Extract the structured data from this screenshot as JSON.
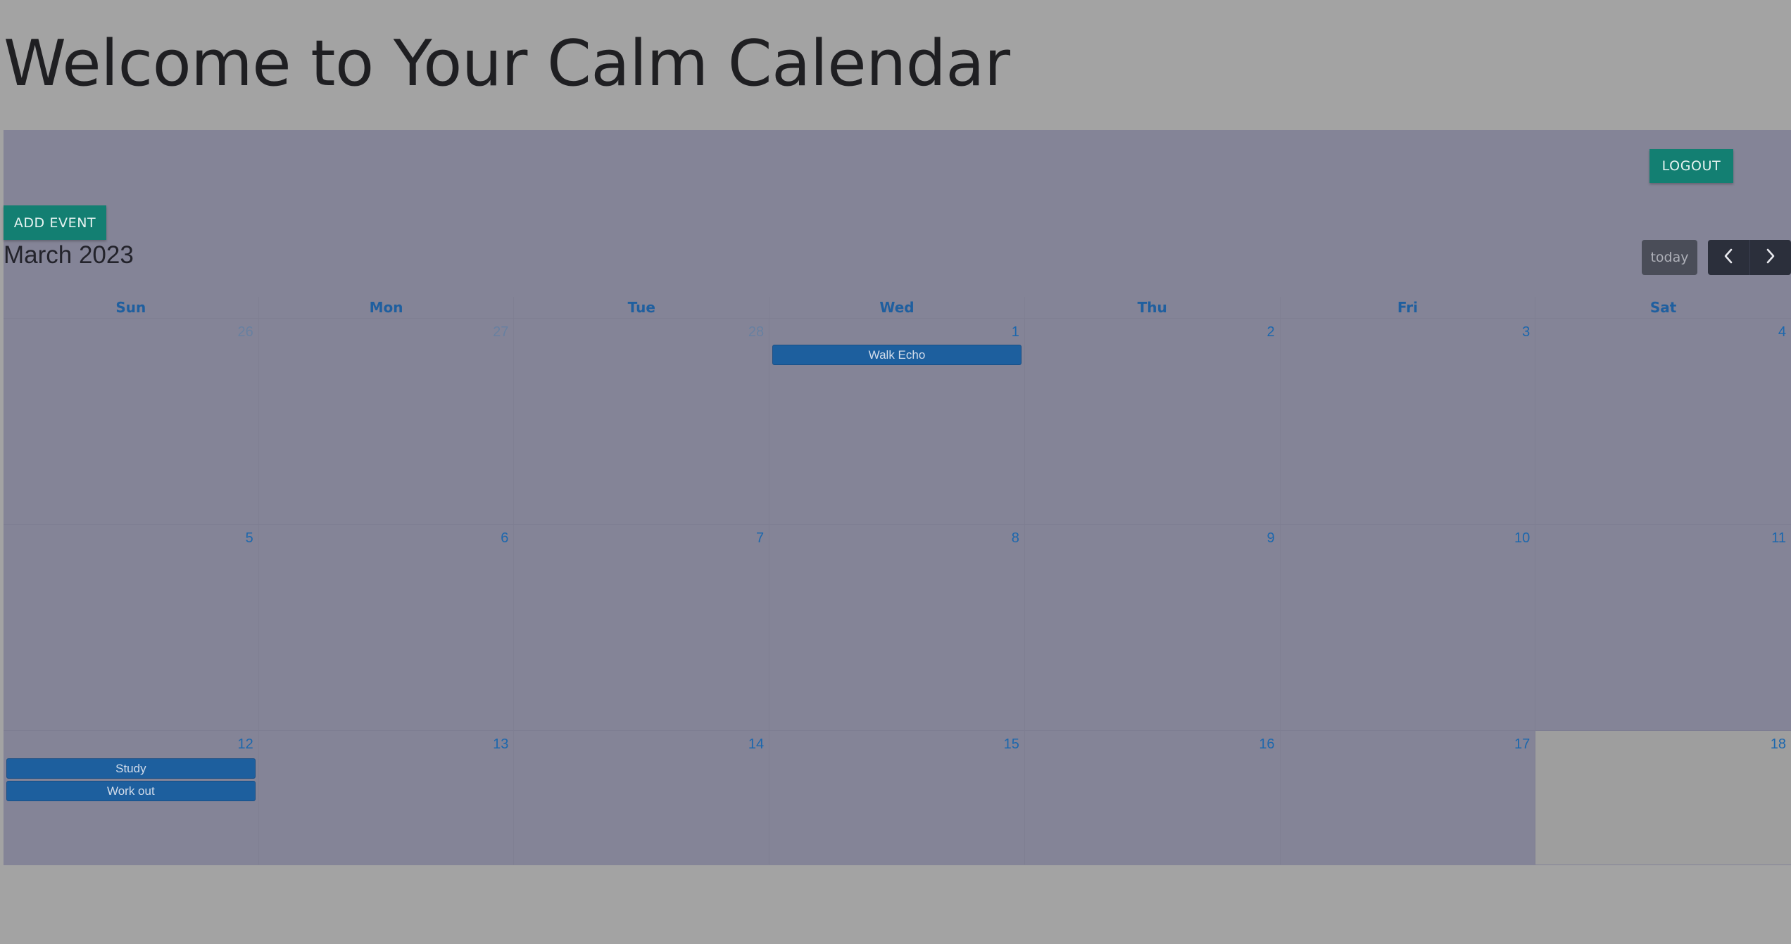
{
  "page": {
    "title": "Welcome to Your Calm Calendar"
  },
  "toolbar": {
    "logout_label": "LOGOUT",
    "add_event_label": "ADD EVENT",
    "month_title": "March 2023",
    "today_label": "today",
    "prev_icon": "chevron-left-icon",
    "next_icon": "chevron-right-icon"
  },
  "calendar": {
    "weekdays": [
      "Sun",
      "Mon",
      "Tue",
      "Wed",
      "Thu",
      "Fri",
      "Sat"
    ],
    "weeks": [
      {
        "days": [
          "26",
          "27",
          "28",
          "1",
          "2",
          "3",
          "4"
        ]
      },
      {
        "days": [
          "5",
          "6",
          "7",
          "8",
          "9",
          "10",
          "11"
        ]
      },
      {
        "days": [
          "12",
          "13",
          "14",
          "15",
          "16",
          "17",
          "18"
        ]
      }
    ],
    "events": [
      {
        "title": "Walk Echo",
        "date": "1"
      },
      {
        "title": "Study",
        "date": "12"
      },
      {
        "title": "Work out",
        "date": "12"
      }
    ],
    "today_date": "18"
  },
  "colors": {
    "accent_teal": "#137f72",
    "event_blue": "#1d5f9e",
    "panel": "#848497",
    "background": "#a3a3a3"
  }
}
